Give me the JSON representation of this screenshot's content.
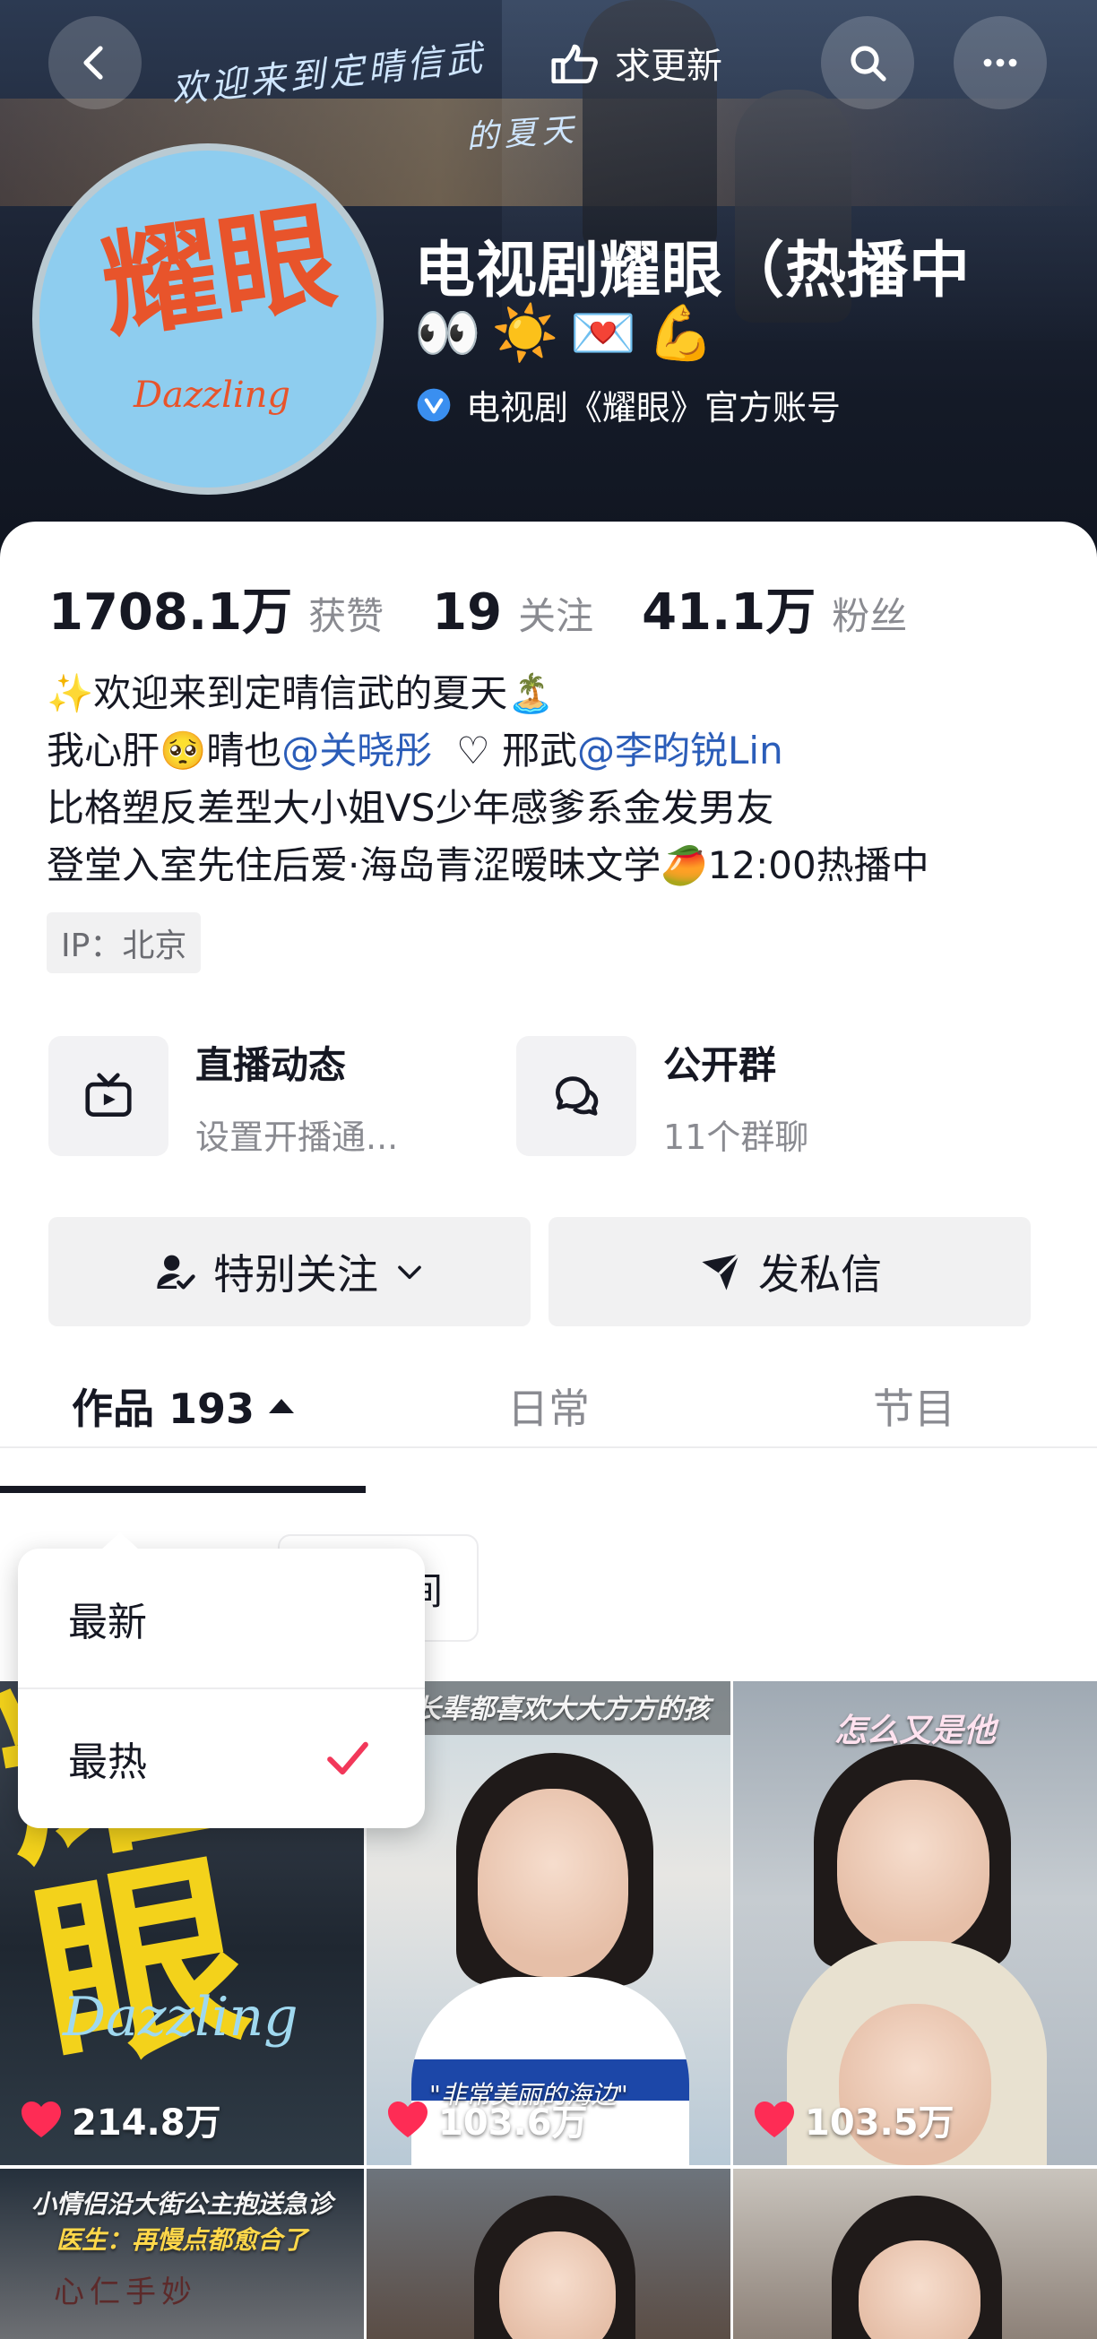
{
  "header": {
    "script_line1": "欢迎来到定晴信武",
    "script_line2": "的夏天",
    "request_update_label": "求更新"
  },
  "profile": {
    "avatar_logo": "耀眼",
    "avatar_sub": "Dazzling",
    "name": "电视剧耀眼（热播中",
    "emojis": [
      "👀",
      "☀️",
      "💌",
      "💪"
    ],
    "verified_text": "电视剧《耀眼》官方账号"
  },
  "stats": {
    "likes_count": "1708.1万",
    "likes_label": "获赞",
    "following_count": "19",
    "following_label": "关注",
    "followers_count": "41.1万",
    "followers_label": "粉丝"
  },
  "bio": {
    "line1": "✨欢迎来到定晴信武的夏天🏝️",
    "line2_a": "我心肝🥺晴也",
    "line2_mention1": "@关晓彤",
    "line2_b": "  ♡ 邢武",
    "line2_mention2": "@李昀锐Lin",
    "line3": "比格塑反差型大小姐VS少年感爹系金发男友",
    "line4": "登堂入室先住后爱·海岛青涩暧昧文学🥭12:00热播中",
    "ip": "IP：北京"
  },
  "features": {
    "live_title": "直播动态",
    "live_sub": "设置开播通...",
    "group_title": "公开群",
    "group_sub": "11个群聊"
  },
  "actions": {
    "follow_label": "特别关注",
    "message_label": "发私信"
  },
  "tabs": {
    "works_label": "作品 193",
    "daily_label": "日常",
    "shows_label": "节目"
  },
  "filter": {
    "chip_label": "间"
  },
  "dropdown": {
    "options": [
      "最新",
      "最热"
    ],
    "selected": "最热"
  },
  "grid": {
    "items": [
      {
        "likes": "214.8万",
        "logo": "耀眼",
        "logo_sub": "Dazzling"
      },
      {
        "likes": "103.6万",
        "caption": "给长辈都喜欢大大方方的孩",
        "subcaption": "\"非常美丽的海边\""
      },
      {
        "likes": "103.5万",
        "caption": "怎么又是他"
      }
    ],
    "row2": [
      {
        "caption": "小情侣沿大街公主抱送急诊",
        "caption2": "医生：再慢点都愈合了",
        "sign": "心仁手妙"
      }
    ]
  },
  "colors": {
    "accent_red": "#fe2c55",
    "mention_blue": "#2b5db9",
    "check_pink": "#f2385a"
  }
}
